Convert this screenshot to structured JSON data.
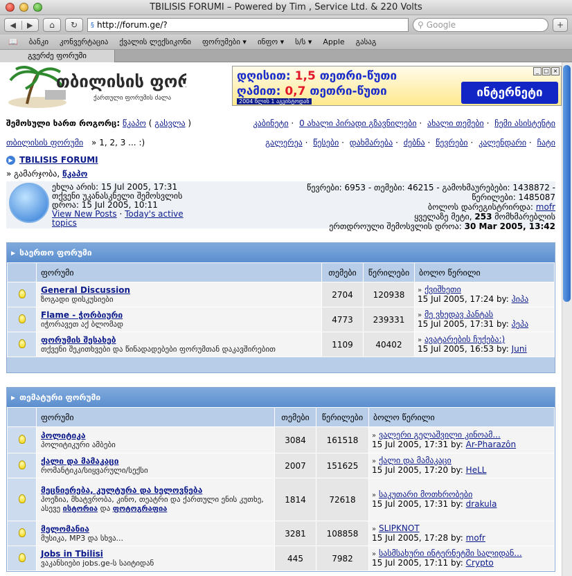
{
  "window": {
    "title": "TBILISIS FORUMI – Powered by Tim , Service Ltd. & 220 Volts"
  },
  "toolbar": {
    "url": "http://forum.ge/?",
    "search_placeholder": "Google",
    "back": "◀",
    "forward": "▶",
    "home": "⌂",
    "reload": "↻",
    "add": "+"
  },
  "bookmarks": [
    "ბანკი",
    "კონვერტაცია",
    "ქვალის ლექსიკონი",
    "ფორუმები ▾",
    "ინფო ▾",
    "ს/ს ▾",
    "Apple",
    "გასაგ"
  ],
  "tab": "გვერძე ფორუმი",
  "banner": {
    "line1a": "დღისით:",
    "line1b": "1,5",
    "line1c": "თეთრი-წუთი",
    "line2a": "ღამით:",
    "line2b": "0,7",
    "line2c": "თეთრი-წუთი",
    "small": "2004 წლის 1 აგვისტოდან",
    "box": "ინტერნეტი"
  },
  "logo": {
    "main": "თბილისის ფორუმი",
    "sub": "ქართული ფორუმის ძალა"
  },
  "nav": {
    "logged_prefix": "შემოსული ხართ როგორც:",
    "user": "წკაპო",
    "logout": "გასვლა",
    "right1": [
      "კაბინეტი",
      "0 ახალი პირადი გზავნილები",
      "ახალი თემები",
      "ჩემი ასისტენტი"
    ],
    "home_link": "თბილისის ფორუმი",
    "pages": "» 1, 2, 3 ... :)",
    "right2": [
      "გალერეა",
      "წესები",
      "დახმარება",
      "ძებნა",
      "წევრები",
      "კალენდარი",
      "ჩატი"
    ]
  },
  "forum_title": "TBILISIS FORUMI",
  "welcome": {
    "prefix": "» გამარჯობა,",
    "user": "წკაპო"
  },
  "info": {
    "now": "ეხლა არის: 15 Jul 2005, 17:31",
    "last_visit": "თქვენი უკანასკნელი შემოსვლის დროა: 15 Jul 2005, 10:11",
    "new_posts": "View New Posts",
    "active": "Today's active topics",
    "stats1": "წევრები: 6953 - თემები: 46215 - გამოხმაურებები: 1438872 -",
    "stats2": "წერილები: 1485087",
    "last_reg_prefix": "ბოლოს დარეგისტრირდა:",
    "last_reg": "mofr",
    "most_prefix": "ყველაზე მეტი,",
    "most_num": "253",
    "most_suffix": "მომხმარებლის",
    "online_prefix": "ერთდროული შემოსვლის დროა:",
    "online_date": "30 Mar 2005, 13:42"
  },
  "cat1": {
    "title": "საერთო ფორუმი",
    "headers": [
      "ფორუმი",
      "თემები",
      "წერილები",
      "ბოლო წერილი"
    ],
    "rows": [
      {
        "name": "General Discussion",
        "desc": "ზოგადი დისკუსიები",
        "topics": "2704",
        "posts": "120938",
        "last_title": "ქვიშხეთი",
        "last_date": "15 Jul 2005, 17:24 by:",
        "last_user": "ჰიპა"
      },
      {
        "name": "Flame - ჭორბიური",
        "desc": "იჭორავეთ აქ ბლომად",
        "topics": "4773",
        "posts": "239331",
        "last_title": "მე ვხედავ პანტას",
        "last_date": "15 Jul 2005, 17:31 by:",
        "last_user": "პეპა"
      },
      {
        "name": "ფორუმის შესახებ",
        "desc": "თქვენი შეკითხვები და წინადადებები ფორუმთან დაკავშირებით",
        "topics": "1109",
        "posts": "40402",
        "last_title": "ავატარების ჩუქება:)",
        "last_date": "15 Jul 2005, 16:53 by:",
        "last_user": "Juni"
      }
    ]
  },
  "cat2": {
    "title": "თემატური ფორუმი",
    "headers": [
      "ფორუმი",
      "თემები",
      "წერილები",
      "ბოლო წერილი"
    ],
    "rows": [
      {
        "name": "პოლიტიკა",
        "desc": "პოლიტიკური ამბები",
        "desc2": "",
        "topics": "3084",
        "posts": "161518",
        "last_title": "ვალერი გელაშვილი კინოამ...",
        "last_date": "15 Jul 2005, 17:31 by:",
        "last_user": "Ar-Pharazôn"
      },
      {
        "name": "ქალი და მამაკაცი",
        "desc": "რომანტიკა/სიყვარული/სექსი",
        "desc2": "",
        "topics": "2007",
        "posts": "151625",
        "last_title": "ქალი და მამაკაცი",
        "last_date": "15 Jul 2005, 17:20 by:",
        "last_user": "HeLL"
      },
      {
        "name": "მეცნიერება, კულტურა და ხელოვნება",
        "desc": "პოეზია, მხატვრობა, კინო, თეატრი და ქართული ენის კუთხე,",
        "desc2": "ასევე",
        "desc2_link1": "ისტორია",
        "desc2_mid": "და",
        "desc2_link2": "ფოტოგრაფია",
        "topics": "1814",
        "posts": "72618",
        "last_title": "საკუთარი მოთხრობები",
        "last_date": "15 Jul 2005, 17:31 by:",
        "last_user": "drakula"
      },
      {
        "name": "მელომანია",
        "desc": "მუსიკა, MP3 და სხვა...",
        "desc2": "",
        "topics": "3281",
        "posts": "108858",
        "last_title": "SLIPKNOT",
        "last_date": "15 Jul 2005, 17:28 by:",
        "last_user": "mofr"
      },
      {
        "name": "Jobs in Tbilisi",
        "desc": "ვაკანსიები jobs.ge-ს საიტიდან",
        "desc2": "",
        "topics": "445",
        "posts": "7982",
        "last_title": "სასმსახური ინტერნეტში სალიდან...",
        "last_date": "15 Jul 2005, 17:11 by:",
        "last_user": "Crypto"
      }
    ]
  }
}
